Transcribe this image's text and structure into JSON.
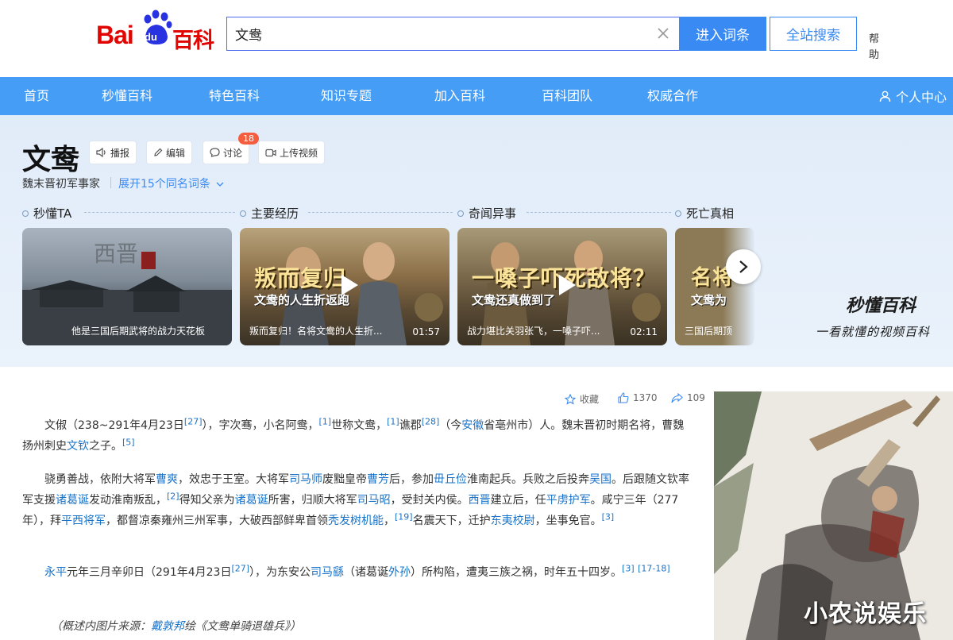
{
  "header": {
    "logo_bai": "Bai",
    "logo_du": "du",
    "logo_baike": "百科",
    "search_value": "文鸯",
    "enter_label": "进入词条",
    "site_search_label": "全站搜索",
    "help_label": "帮助"
  },
  "nav": {
    "items": [
      "首页",
      "秒懂百科",
      "特色百科",
      "知识专题",
      "加入百科",
      "百科团队",
      "权威合作"
    ],
    "user_center": "个人中心"
  },
  "entry": {
    "title": "文鸯",
    "tools": [
      "播报",
      "编辑",
      "讨论",
      "上传视频"
    ],
    "discuss_count": "18",
    "subtitle": "魏末晋初军事家",
    "expand": "展开15个同名词条"
  },
  "sections": [
    "秒懂TA",
    "主要经历",
    "奇闻异事",
    "死亡真相"
  ],
  "cards": [
    {
      "caption": "他是三国后期武将的战力天花板",
      "duration": "",
      "headline": "",
      "subhead": ""
    },
    {
      "caption": "叛而复归！名将文鸯的人生折...",
      "duration": "01:57",
      "headline": "叛而复归",
      "subhead": "文鸯的人生折返跑"
    },
    {
      "caption": "战力堪比关羽张飞，一嗓子吓...",
      "duration": "02:11",
      "headline": "一嗓子吓死敌将？",
      "subhead": "文鸯还真做到了"
    },
    {
      "caption": "三国后期顶",
      "duration": "",
      "headline": "名将",
      "subhead": "文鸯为"
    }
  ],
  "brand": {
    "miaodong": "秒懂百科",
    "slogan": "一看就懂的视频百科"
  },
  "stats": {
    "favorite_label": "收藏",
    "likes": "1370",
    "shares": "109"
  },
  "content": {
    "p1": {
      "t1": "文俶（238~291年4月23日",
      "s1": "[27]",
      "t2": "），字次骞，小名阿鸯，",
      "s2": "[1]",
      "t3": "世称文鸯，",
      "s3": "[1]",
      "t4": "谯郡",
      "s4": "[28]",
      "t5": "（今",
      "l1": "安徽",
      "t6": "省亳州市）人。魏末晋初时期名将，曹魏扬州刺史",
      "l2": "文钦",
      "t7": "之子。",
      "s5": "[5]"
    },
    "p2": {
      "t1": "骁勇善战，依附大将军",
      "l1": "曹爽",
      "t2": "，效忠于王室。大将军",
      "l2": "司马师",
      "t3": "废黜皇帝",
      "l3": "曹芳",
      "t4": "后，参加",
      "l4": "毌丘俭",
      "t5": "淮南起兵。兵败之后投奔",
      "l5": "吴国",
      "t6": "。后跟随文钦率军支援",
      "l6": "诸葛诞",
      "t7": "发动淮南叛乱，",
      "s1": "[2]",
      "t8": "得知父亲为",
      "l7": "诸葛诞",
      "t9": "所害，归顺大将军",
      "l8": "司马昭",
      "t10": "，受封关内侯。",
      "l9": "西晋",
      "t11": "建立后，任",
      "l10": "平虏护军",
      "t12": "。咸宁三年（277年），拜",
      "l11": "平西将军",
      "t13": "，都督凉秦雍州三州军事，大破西部鲜卑首领",
      "l12": "秃发树机能",
      "t14": "，",
      "s2": "[19]",
      "t15": "名震天下，迁护",
      "l13": "东夷校尉",
      "t16": "，坐事免官。",
      "s3": "[3]"
    },
    "p3": {
      "l1": "永平",
      "t1": "元年三月辛卯日（291年4月23日",
      "s1": "[27]",
      "t2": "），为东安公",
      "l2": "司马繇",
      "t3": "（诸葛诞",
      "l3": "外孙",
      "t4": "）所构陷，遭夷三族之祸，时年五十四岁。",
      "s2": "[3]",
      "s3": "[17-18]"
    },
    "note": {
      "prefix": "（概述内图片来源：",
      "author": "戴敦邦",
      "suffix": "绘《文鸯单骑退雄兵》）"
    }
  },
  "watermark": "小农说娱乐",
  "colors": {
    "brand_red": "#e10602",
    "brand_blue": "#2932e1",
    "nav_blue": "#459df5",
    "link_blue": "#1a73c8",
    "button_blue": "#3a8af3"
  }
}
